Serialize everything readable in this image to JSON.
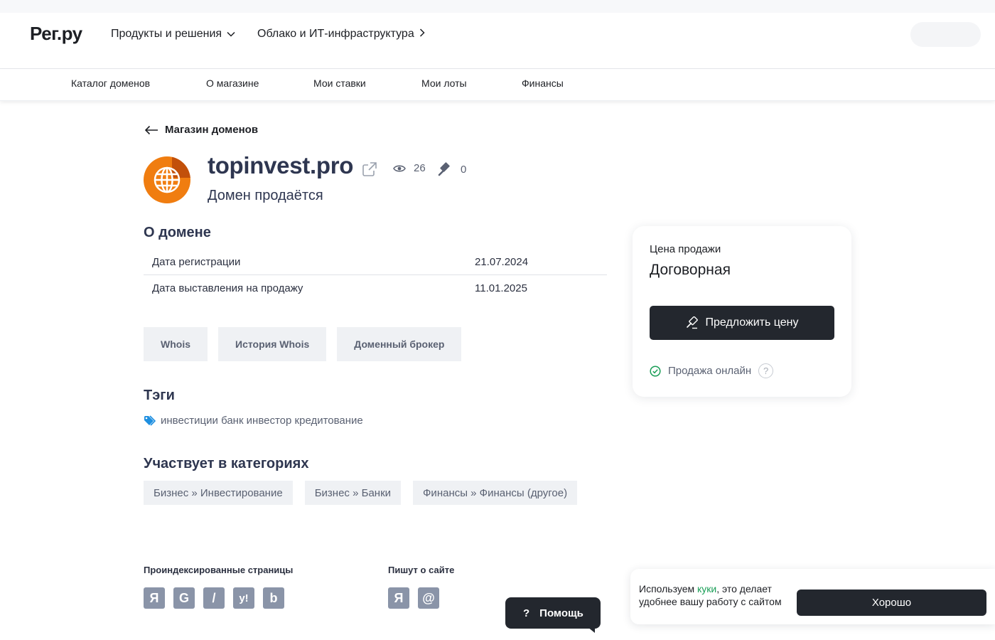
{
  "header": {
    "logo": "Рег.ру",
    "nav": [
      {
        "label": "Продукты и решения"
      },
      {
        "label": "Облако и ИТ-инфраструктура"
      }
    ]
  },
  "subnav": [
    "Каталог доменов",
    "О магазине",
    "Мои ставки",
    "Мои лоты",
    "Финансы"
  ],
  "back": {
    "label": "Магазин доменов"
  },
  "domain": {
    "name": "topinvest.pro",
    "views": "26",
    "bids": "0",
    "status": "Домен продаётся"
  },
  "about": {
    "title": "О домене",
    "rows": [
      {
        "key": "Дата регистрации",
        "value": "21.07.2024"
      },
      {
        "key": "Дата выставления на продажу",
        "value": "11.01.2025"
      }
    ]
  },
  "tools": [
    "Whois",
    "История Whois",
    "Доменный брокер"
  ],
  "tags": {
    "title": "Тэги",
    "text": "инвестиции банк инвестор кредитование"
  },
  "categories": {
    "title": "Участвует в категориях",
    "items": [
      "Бизнес » Инвестирование",
      "Бизнес » Банки",
      "Финансы » Финансы (другое)"
    ]
  },
  "price": {
    "label": "Цена продажи",
    "value": "Договорная",
    "button": "Предложить цену",
    "online": "Продажа онлайн",
    "help_glyph": "?"
  },
  "indexed": {
    "title": "Проиндексированные страницы",
    "engines": [
      "Я",
      "G",
      "/",
      "y!",
      "b"
    ]
  },
  "mentions": {
    "title": "Пишут о сайте",
    "sources": [
      "Я",
      "@"
    ]
  },
  "help": {
    "glyph": "?",
    "label": "Помощь"
  },
  "cookie": {
    "text_before": "Используем ",
    "link": "куки",
    "text_after": ", это делает удобнее вашу работу с сайтом",
    "button": "Хорошо"
  },
  "colors": {
    "accent_dark": "#23272e",
    "domain_logo": "#f07d10",
    "tag_icon": "#1e8fe0",
    "online_check": "#1a9e57",
    "cookie_link": "#1a9e57"
  }
}
